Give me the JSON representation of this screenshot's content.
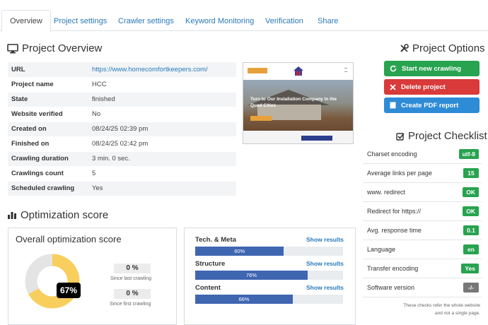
{
  "tabs": [
    {
      "label": "Overview"
    },
    {
      "label": "Project settings"
    },
    {
      "label": "Crawler settings"
    },
    {
      "label": "Keyword Monitoring"
    },
    {
      "label": "Verification"
    },
    {
      "label": "Share"
    }
  ],
  "overview": {
    "title": "Project Overview",
    "rows": [
      {
        "key": "URL",
        "value": "https://www.homecomfortkeepers.com/"
      },
      {
        "key": "Project name",
        "value": "HCC"
      },
      {
        "key": "State",
        "value": "finished"
      },
      {
        "key": "Website verified",
        "value": "No"
      },
      {
        "key": "Created on",
        "value": "08/24/25 02:39 pm"
      },
      {
        "key": "Finished on",
        "value": "08/24/25 02:42 pm"
      },
      {
        "key": "Crawling duration",
        "value": "3 min. 0 sec."
      },
      {
        "key": "Crawlings count",
        "value": "5"
      },
      {
        "key": "Scheduled crawling",
        "value": "Yes"
      }
    ]
  },
  "thumbnail": {
    "hero_text": "Turn to Our Installation Company in the Quad Cities"
  },
  "options": {
    "title": "Project Options",
    "start": "Start new crawling",
    "delete": "Delete project",
    "pdf": "Create PDF report"
  },
  "checklist": {
    "title": "Project Checklist",
    "items": [
      {
        "label": "Charset encoding",
        "value": "utf-8"
      },
      {
        "label": "Average links per page",
        "value": "15"
      },
      {
        "label": "www. redirect",
        "value": "OK"
      },
      {
        "label": "Redirect for https://",
        "value": "OK"
      },
      {
        "label": "Avg. response time",
        "value": "0.1"
      },
      {
        "label": "Language",
        "value": "en"
      },
      {
        "label": "Transfer encoding",
        "value": "Yes"
      },
      {
        "label": "Software version",
        "value": "-/-"
      }
    ],
    "note_line1": "These checks refer the whole website",
    "note_line2": "and not a single page."
  },
  "optimization": {
    "title": "Optimization score",
    "panel_title": "Overall optimization score",
    "score_percent": 67,
    "score_label": "67%",
    "since_last_value": "0 %",
    "since_last_caption": "Since last crawling",
    "since_first_value": "0 %",
    "since_first_caption": "Since first crawling"
  },
  "categories": [
    {
      "label": "Tech. & Meta",
      "link": "Show results",
      "percent": 60,
      "percent_label": "60%"
    },
    {
      "label": "Structure",
      "link": "Show results",
      "percent": 76,
      "percent_label": "76%"
    },
    {
      "label": "Content",
      "link": "Show results",
      "percent": 66,
      "percent_label": "66%"
    }
  ],
  "colors": {
    "accent": "#2a7ab8",
    "donut_fill": "#f8ce5d",
    "donut_rest": "#e4e4e4",
    "bar_fill": "#3f66b1",
    "ok_green": "#28a34f"
  }
}
